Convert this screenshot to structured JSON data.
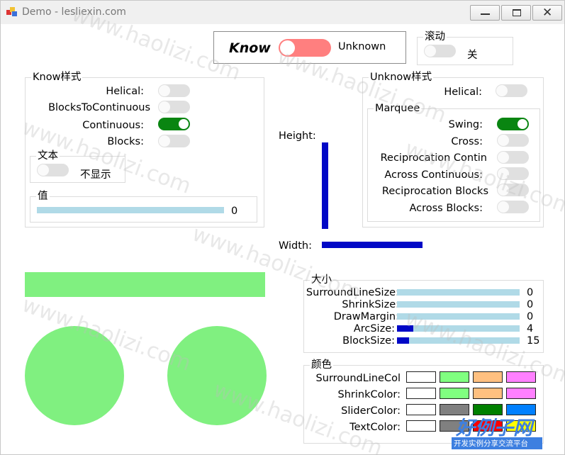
{
  "window": {
    "title": "Demo - lesliexin.com"
  },
  "top": {
    "know_label": "Know",
    "unknown_label": "Unknown"
  },
  "scroll_group": {
    "title": "滚动",
    "state": "关"
  },
  "know_style": {
    "title": "Know样式",
    "rows": [
      {
        "label": "Helical:",
        "on": false
      },
      {
        "label": "BlocksToContinuous",
        "on": false
      },
      {
        "label": "Continuous:",
        "on": true
      },
      {
        "label": "Blocks:",
        "on": false
      }
    ],
    "text_group": {
      "title": "文本",
      "state": "不显示"
    },
    "value_group": {
      "title": "值",
      "value": "0",
      "progress": 0
    }
  },
  "unknown_style": {
    "title": "Unknow样式",
    "helical_label": "Helical:",
    "marquee": {
      "title": "Marquee",
      "rows": [
        {
          "label": "Swing:",
          "on": true
        },
        {
          "label": "Cross:",
          "on": false
        },
        {
          "label": "Reciprocation Contin",
          "on": false
        },
        {
          "label": "Across Continuous:",
          "on": false
        },
        {
          "label": "Reciprocation Blocks",
          "on": false
        },
        {
          "label": "Across Blocks:",
          "on": false
        }
      ]
    }
  },
  "dims": {
    "height_label": "Height:",
    "width_label": "Width:"
  },
  "size_group": {
    "title": "大小",
    "rows": [
      {
        "label": "SurroundLineSize:",
        "value": "0",
        "fraction": 0
      },
      {
        "label": "ShrinkSize:",
        "value": "0",
        "fraction": 0
      },
      {
        "label": "DrawMargin:",
        "value": "0",
        "fraction": 0
      },
      {
        "label": "ArcSize:",
        "value": "4",
        "fraction": 0.13
      },
      {
        "label": "BlockSize:",
        "value": "15",
        "fraction": 0.1
      }
    ]
  },
  "color_group": {
    "title": "颜色",
    "rows": [
      {
        "label": "SurroundLineCol",
        "colors": [
          "#ffffff",
          "#80ff80",
          "#ffc080",
          "#ff80ff"
        ]
      },
      {
        "label": "ShrinkColor:",
        "colors": [
          "#ffffff",
          "#80ff80",
          "#ffc080",
          "#ff80ff"
        ]
      },
      {
        "label": "SliderColor:",
        "colors": [
          "#ffffff",
          "#808080",
          "#008000",
          "#0080ff"
        ]
      },
      {
        "label": "TextColor:",
        "colors": [
          "#ffffff",
          "#808080",
          "#ff0000",
          "#ffff00"
        ]
      }
    ]
  },
  "preview": {
    "shape_color": "#80f080"
  },
  "watermark": {
    "text": "www.haolizi.com",
    "logo": "好例子网",
    "logo_sub": "开发实例分享交流平台"
  },
  "colors": {
    "accent_blue": "#0008c6",
    "toggle_on": "#098511",
    "toggle_big": "#ff7f7f",
    "bar_bg": "#b0dae7"
  }
}
